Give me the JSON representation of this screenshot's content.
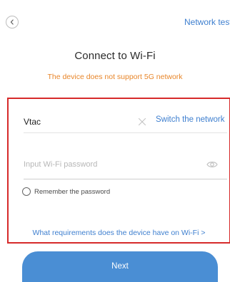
{
  "header": {
    "back_icon": "chevron-left-icon",
    "network_testing_label": "Network testir"
  },
  "title": "Connect to Wi-Fi",
  "warning": "The device does not support 5G network",
  "wifi_form": {
    "ssid_value": "Vtac",
    "clear_icon": "close-icon",
    "switch_network_label": "Switch the network",
    "password_placeholder": "Input Wi-Fi password",
    "password_value": "",
    "show_password_icon": "eye-icon",
    "remember_label": "Remember the password",
    "remember_checked": false,
    "requirements_link": "What requirements does the device have on Wi-Fi >"
  },
  "next_button_label": "Next",
  "colors": {
    "accent": "#3e7fcf",
    "warning": "#e8862a",
    "highlight_border": "#d62a2a",
    "button": "#4a8ed4"
  }
}
